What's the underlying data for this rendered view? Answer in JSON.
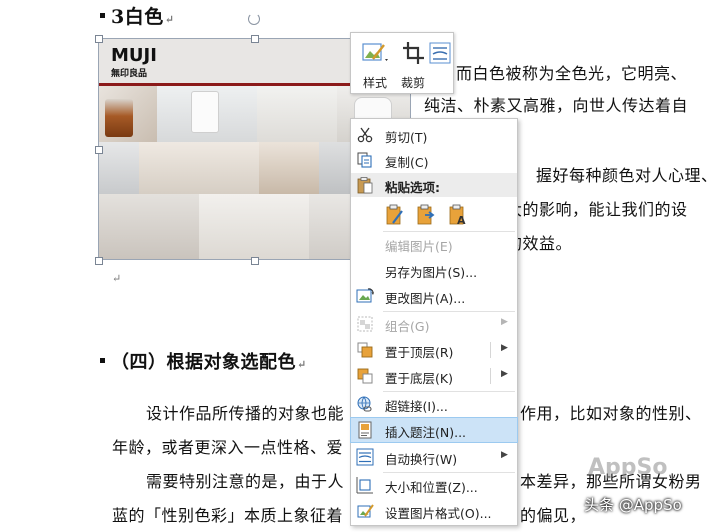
{
  "doc": {
    "heading_color": "3白色",
    "side_text": [
      "而白色被称为全色光，它明亮、",
      "纯洁、朴素又高雅，向世人传达着自",
      "握好每种颜色对人心理、",
      "大的影响，能让我们的设",
      "的效益。"
    ],
    "section_heading": "（四）根据对象选配色",
    "body_lines": [
      "设计作品所传播的对象也能",
      "作用，比如对象的性别、",
      "年龄，或者更深入一点性格、爱",
      "需要特别注意的是，由于人",
      "本差异，那些所谓女粉男",
      "蓝的「性别色彩」本质上象征着",
      "的偏见，"
    ]
  },
  "picture": {
    "logo": "MUJI",
    "subtitle": "無印良品"
  },
  "mini_toolbar": {
    "style_label": "样式",
    "crop_label": "裁剪"
  },
  "context_menu": {
    "cut": "剪切(T)",
    "copy": "复制(C)",
    "paste_options": "粘贴选项:",
    "edit_picture": "编辑图片(E)",
    "save_as_picture": "另存为图片(S)...",
    "change_picture": "更改图片(A)...",
    "group": "组合(G)",
    "bring_to_front": "置于顶层(R)",
    "send_to_back": "置于底层(K)",
    "hyperlink": "超链接(I)...",
    "insert_caption": "插入题注(N)...",
    "wrap_text": "自动换行(W)",
    "size_position": "大小和位置(Z)...",
    "format_picture": "设置图片格式(O)..."
  },
  "watermark": "AppSo",
  "toutiao": "头条 @AppSo",
  "colors": {
    "highlight": "#cce3f7",
    "muji_red": "#8b1a1a",
    "icon_blue": "#2f6fb7",
    "icon_orange": "#e8a23a"
  }
}
